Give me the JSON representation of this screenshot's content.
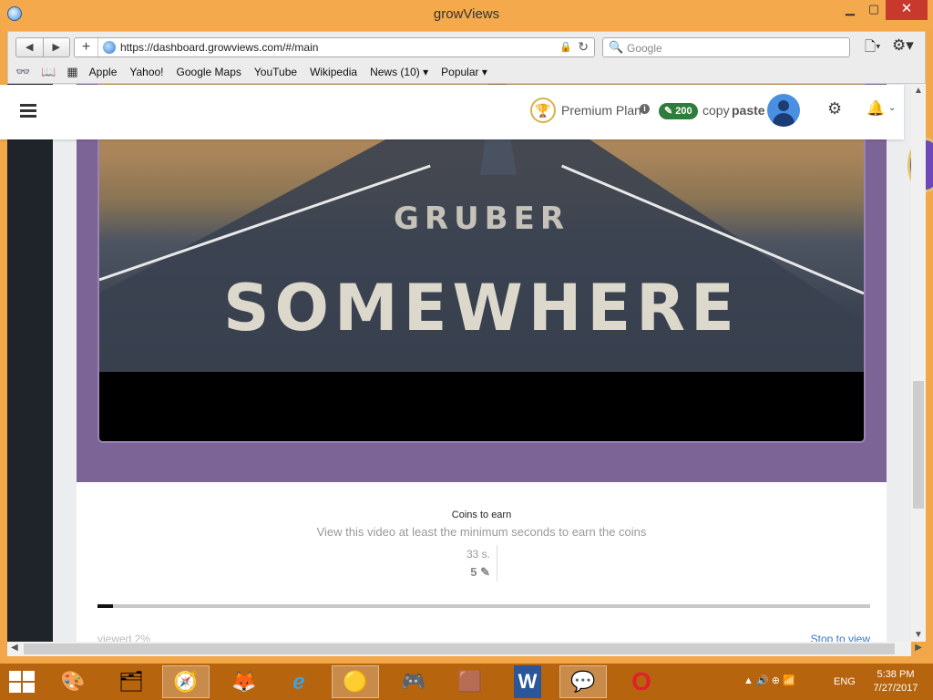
{
  "window": {
    "title": "growViews",
    "min": "▁",
    "max": "▢",
    "close": "✕"
  },
  "toolbar": {
    "back": "◀",
    "forward": "▶",
    "new_tab": "+",
    "url": "https://dashboard.growviews.com/#/main",
    "lock": "🔒",
    "reload": "↻",
    "search_placeholder": "Google",
    "page_menu": "🗋▾",
    "settings_menu": "⚙▾"
  },
  "bookmarks": {
    "reading_list_icon": "👓",
    "bookmarks_icon": "📖",
    "top_sites_icon": "▦",
    "items": [
      "Apple",
      "Yahoo!",
      "Google Maps",
      "YouTube",
      "Wikipedia",
      "News (10) ▾",
      "Popular ▾"
    ]
  },
  "video": {
    "overlay_small": "GRUBER",
    "overlay_big": "SOMEWHERE"
  },
  "header": {
    "plan": "Premium Plan",
    "info": "i",
    "coins": "✎ 200",
    "user_first": "copy",
    "user_last": "paste",
    "trophy": "🏆",
    "gear": "⚙",
    "bell": "🔔",
    "chevron": "⌄"
  },
  "earn": {
    "title": "Coins to earn",
    "description": "View this video at least the minimum seconds to earn the coins",
    "seconds": "33 s.",
    "coins": "5 ✎",
    "progress_pct": 2,
    "viewed": "viewed 2%",
    "stop": "Stop to view"
  },
  "taskbar": {
    "apps": [
      "🎨",
      "🗂",
      "🧭",
      "🦊",
      "ℯ",
      "🟡",
      "🎮",
      "🟫",
      "W",
      "💬",
      "O"
    ],
    "tray_icons": "▲ 🔊 ⊕ 📶",
    "lang": "ENG",
    "time": "5:38 PM",
    "date": "7/27/2017"
  },
  "colors": {
    "window_chrome": "#f3a94c",
    "taskbar": "#b7640e",
    "video_frame": "#7d6496",
    "coin_badge": "#2f7d3a",
    "close": "#c7392d"
  }
}
